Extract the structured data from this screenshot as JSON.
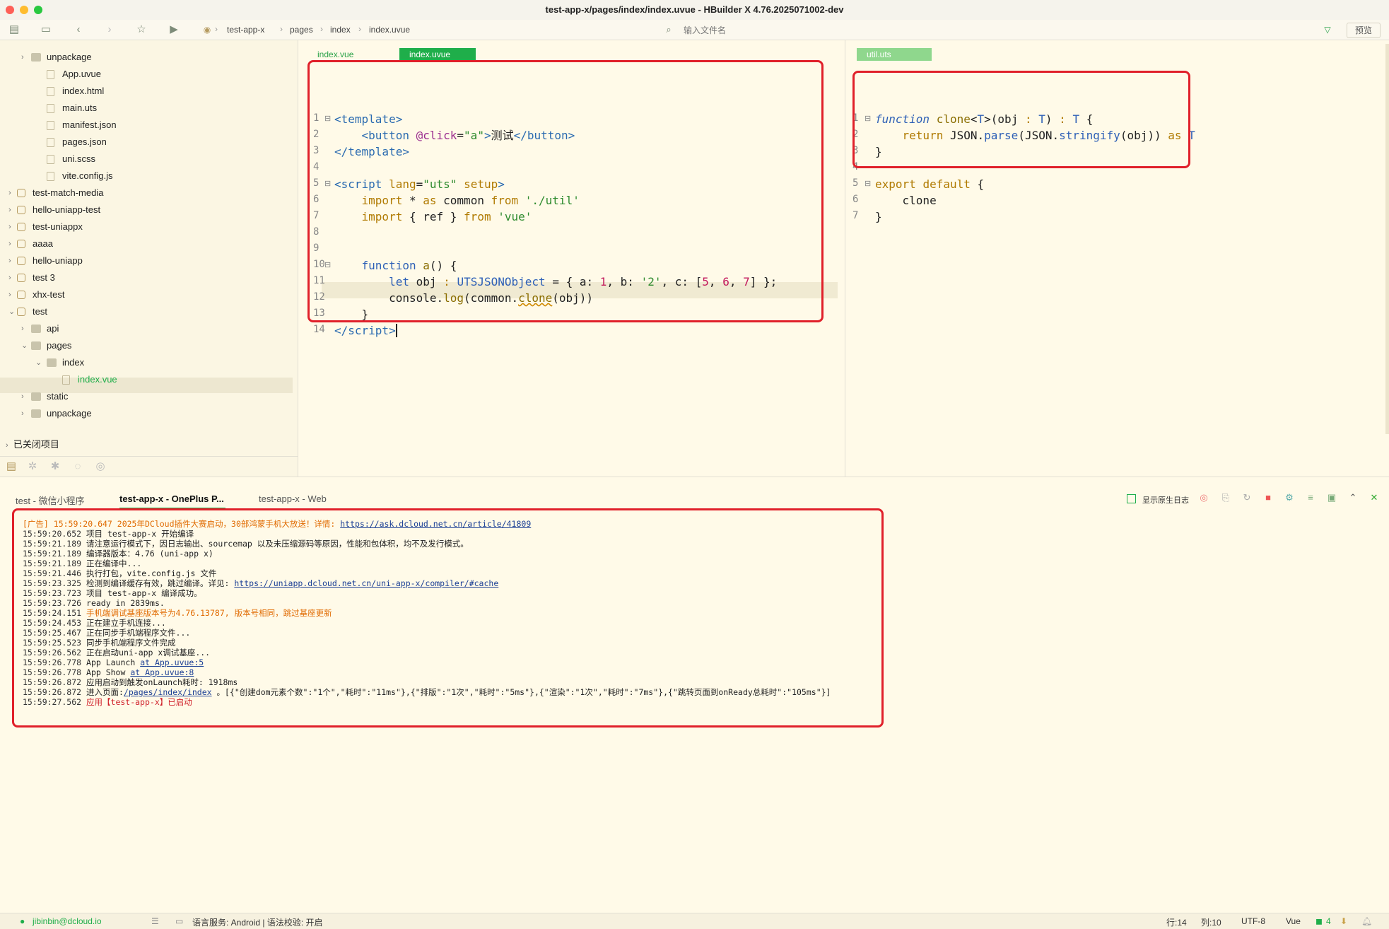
{
  "window": {
    "title": "test-app-x/pages/index/index.uvue - HBuilder X 4.76.2025071002-dev"
  },
  "breadcrumb": [
    "test-app-x",
    "pages",
    "index",
    "index.uvue"
  ],
  "search": {
    "placeholder": "输入文件名"
  },
  "toolbar": {
    "preview_label": "预览"
  },
  "sidebar": {
    "items": [
      {
        "label": "unpackage",
        "type": "folder",
        "indent": 1,
        "chevron": "›"
      },
      {
        "label": "App.uvue",
        "type": "file",
        "indent": 2,
        "chevron": ""
      },
      {
        "label": "index.html",
        "type": "file",
        "indent": 2,
        "chevron": ""
      },
      {
        "label": "main.uts",
        "type": "file",
        "indent": 2,
        "chevron": ""
      },
      {
        "label": "manifest.json",
        "type": "file",
        "indent": 2,
        "chevron": ""
      },
      {
        "label": "pages.json",
        "type": "file",
        "indent": 2,
        "chevron": ""
      },
      {
        "label": "uni.scss",
        "type": "file",
        "indent": 2,
        "chevron": ""
      },
      {
        "label": "vite.config.js",
        "type": "file",
        "indent": 2,
        "chevron": ""
      },
      {
        "label": "test-match-media",
        "type": "project",
        "indent": 0,
        "chevron": "›"
      },
      {
        "label": "hello-uniapp-test",
        "type": "project",
        "indent": 0,
        "chevron": "›"
      },
      {
        "label": "test-uniappx",
        "type": "project",
        "indent": 0,
        "chevron": "›"
      },
      {
        "label": "aaaa",
        "type": "project",
        "indent": 0,
        "chevron": "›"
      },
      {
        "label": "hello-uniapp",
        "type": "project",
        "indent": 0,
        "chevron": "›"
      },
      {
        "label": "test 3",
        "type": "project",
        "indent": 0,
        "chevron": "›"
      },
      {
        "label": "xhx-test",
        "type": "project",
        "indent": 0,
        "chevron": "›"
      },
      {
        "label": "test",
        "type": "project",
        "indent": 0,
        "chevron": "⌄"
      },
      {
        "label": "api",
        "type": "folder",
        "indent": 1,
        "chevron": "›"
      },
      {
        "label": "pages",
        "type": "folder",
        "indent": 1,
        "chevron": "⌄"
      },
      {
        "label": "index",
        "type": "folder",
        "indent": 2,
        "chevron": "⌄"
      },
      {
        "label": "index.vue",
        "type": "file",
        "indent": 3,
        "chevron": "",
        "selected": true
      },
      {
        "label": "static",
        "type": "folder",
        "indent": 1,
        "chevron": "›"
      },
      {
        "label": "unpackage",
        "type": "folder",
        "indent": 1,
        "chevron": "›"
      }
    ],
    "closed_projects": "已关闭项目"
  },
  "editor_left": {
    "tabs": [
      "index.vue",
      "index.uvue"
    ],
    "line_numbers": [
      "1",
      "2",
      "3",
      "4",
      "5",
      "6",
      "7",
      "8",
      "9",
      "10",
      "11",
      "12",
      "13",
      "14"
    ]
  },
  "editor_right": {
    "tabs": [
      "util.uts"
    ],
    "line_numbers": [
      "1",
      "2",
      "3",
      "4",
      "5",
      "6",
      "7"
    ]
  },
  "console": {
    "tabs": [
      "test - 微信小程序",
      "test-app-x - OnePlus P...",
      "test-app-x - Web"
    ],
    "native_log_label": "显示原生日志",
    "lines": [
      {
        "ts": "[广告] 15:59:20.647 ",
        "text": "2025年DCloud插件大赛启动，30部鸿蒙手机大放送！详情: ",
        "link": "https://ask.dcloud.net.cn/article/41809",
        "style": "orange"
      },
      {
        "ts": "15:59:20.652 ",
        "text": "项目 test-app-x 开始编译",
        "link": "",
        "style": ""
      },
      {
        "ts": "15:59:21.189 ",
        "text": "请注意运行模式下，因日志输出、sourcemap 以及未压缩源码等原因，性能和包体积，均不及发行模式。",
        "link": "",
        "style": ""
      },
      {
        "ts": "15:59:21.189 ",
        "text": "编译器版本：4.76 (uni-app x)",
        "link": "",
        "style": ""
      },
      {
        "ts": "15:59:21.189 ",
        "text": "正在编译中...",
        "link": "",
        "style": ""
      },
      {
        "ts": "15:59:21.446 ",
        "text": "执行打包，vite.config.js 文件",
        "link": "",
        "style": ""
      },
      {
        "ts": "15:59:23.325 ",
        "text": "检测到编译缓存有效，跳过编译。详见: ",
        "link": "https://uniapp.dcloud.net.cn/uni-app-x/compiler/#cache",
        "style": ""
      },
      {
        "ts": "15:59:23.723 ",
        "text": "项目 test-app-x 编译成功。",
        "link": "",
        "style": ""
      },
      {
        "ts": "15:59:23.726 ",
        "text": "ready in 2839ms.",
        "link": "",
        "style": ""
      },
      {
        "ts": "15:59:24.151 ",
        "text": "手机端调试基座版本号为4.76.13787, 版本号相同，跳过基座更新",
        "link": "",
        "style": "orange"
      },
      {
        "ts": "15:59:24.453 ",
        "text": "正在建立手机连接...",
        "link": "",
        "style": ""
      },
      {
        "ts": "15:59:25.467 ",
        "text": "正在同步手机端程序文件...",
        "link": "",
        "style": ""
      },
      {
        "ts": "15:59:25.523 ",
        "text": "同步手机端程序文件完成",
        "link": "",
        "style": ""
      },
      {
        "ts": "15:59:26.562 ",
        "text": "正在启动uni-app x调试基座...",
        "link": "",
        "style": ""
      },
      {
        "ts": "15:59:26.778 ",
        "text": "App Launch ",
        "link": "at App.uvue:5",
        "style": ""
      },
      {
        "ts": "15:59:26.778 ",
        "text": "App Show ",
        "link": "at App.uvue:8",
        "style": ""
      },
      {
        "ts": "15:59:26.872 ",
        "text": "应用启动到触发onLaunch耗时: 1918ms",
        "link": "",
        "style": ""
      },
      {
        "ts": "15:59:26.872 ",
        "text": "进入页面:",
        "link": "/pages/index/index",
        "tail": " 。[{\"创建dom元素个数\":\"1个\",\"耗时\":\"11ms\"},{\"排版\":\"1次\",\"耗时\":\"5ms\"},{\"渲染\":\"1次\",\"耗时\":\"7ms\"},{\"跳转页面到onReady总耗时\":\"105ms\"}]",
        "style": ""
      },
      {
        "ts": "15:59:27.562 ",
        "text": "应用【test-app-x】已启动",
        "link": "",
        "style": "red"
      }
    ]
  },
  "statusbar": {
    "user": "jibinbin@dcloud.io",
    "language_service": "语言服务: Android | 语法校验: 开启",
    "line": "行:14",
    "col": "列:10",
    "encoding": "UTF-8",
    "lang": "Vue",
    "badge": "4"
  },
  "colors": {
    "accent": "#1fae4a",
    "highlight_box": "#e0202a",
    "background": "#fffae8"
  }
}
